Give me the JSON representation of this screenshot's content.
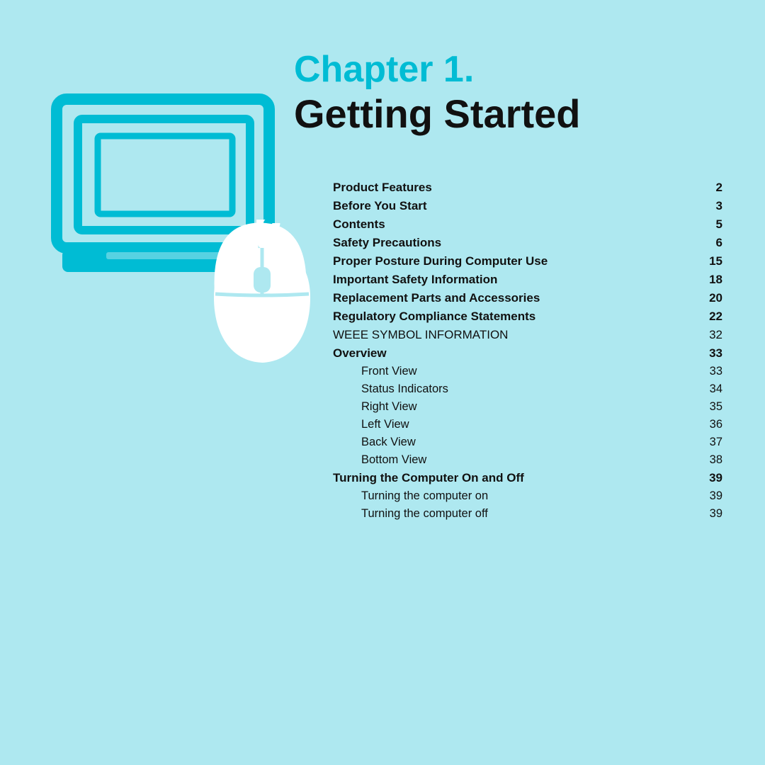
{
  "background_color": "#aee8f0",
  "chapter": {
    "label": "Chapter 1.",
    "subtitle": "Getting Started"
  },
  "toc": {
    "items": [
      {
        "title": "Product Features",
        "page": "2",
        "bold": true,
        "sub": false
      },
      {
        "title": "Before You Start",
        "page": "3",
        "bold": true,
        "sub": false
      },
      {
        "title": "Contents",
        "page": "5",
        "bold": true,
        "sub": false
      },
      {
        "title": "Safety Precautions",
        "page": "6",
        "bold": true,
        "sub": false
      },
      {
        "title": "Proper Posture During Computer Use",
        "page": "15",
        "bold": true,
        "sub": false
      },
      {
        "title": "Important Safety Information",
        "page": "18",
        "bold": true,
        "sub": false
      },
      {
        "title": "Replacement Parts and Accessories",
        "page": "20",
        "bold": true,
        "sub": false
      },
      {
        "title": "Regulatory Compliance Statements",
        "page": "22",
        "bold": true,
        "sub": false
      },
      {
        "title": "WEEE SYMBOL INFORMATION",
        "page": "32",
        "bold": false,
        "sub": false
      },
      {
        "title": "Overview",
        "page": "33",
        "bold": true,
        "sub": false
      },
      {
        "title": "Front View",
        "page": "33",
        "bold": false,
        "sub": true
      },
      {
        "title": "Status Indicators",
        "page": "34",
        "bold": false,
        "sub": true
      },
      {
        "title": "Right View",
        "page": "35",
        "bold": false,
        "sub": true
      },
      {
        "title": "Left View",
        "page": "36",
        "bold": false,
        "sub": true
      },
      {
        "title": "Back View",
        "page": "37",
        "bold": false,
        "sub": true
      },
      {
        "title": "Bottom View",
        "page": "38",
        "bold": false,
        "sub": true
      },
      {
        "title": "Turning the Computer On and Off",
        "page": "39",
        "bold": true,
        "sub": false
      },
      {
        "title": "Turning the computer on",
        "page": "39",
        "bold": false,
        "sub": true
      },
      {
        "title": "Turning the computer off",
        "page": "39",
        "bold": false,
        "sub": true
      }
    ]
  },
  "accent_color": "#00bcd4",
  "text_color": "#111111"
}
